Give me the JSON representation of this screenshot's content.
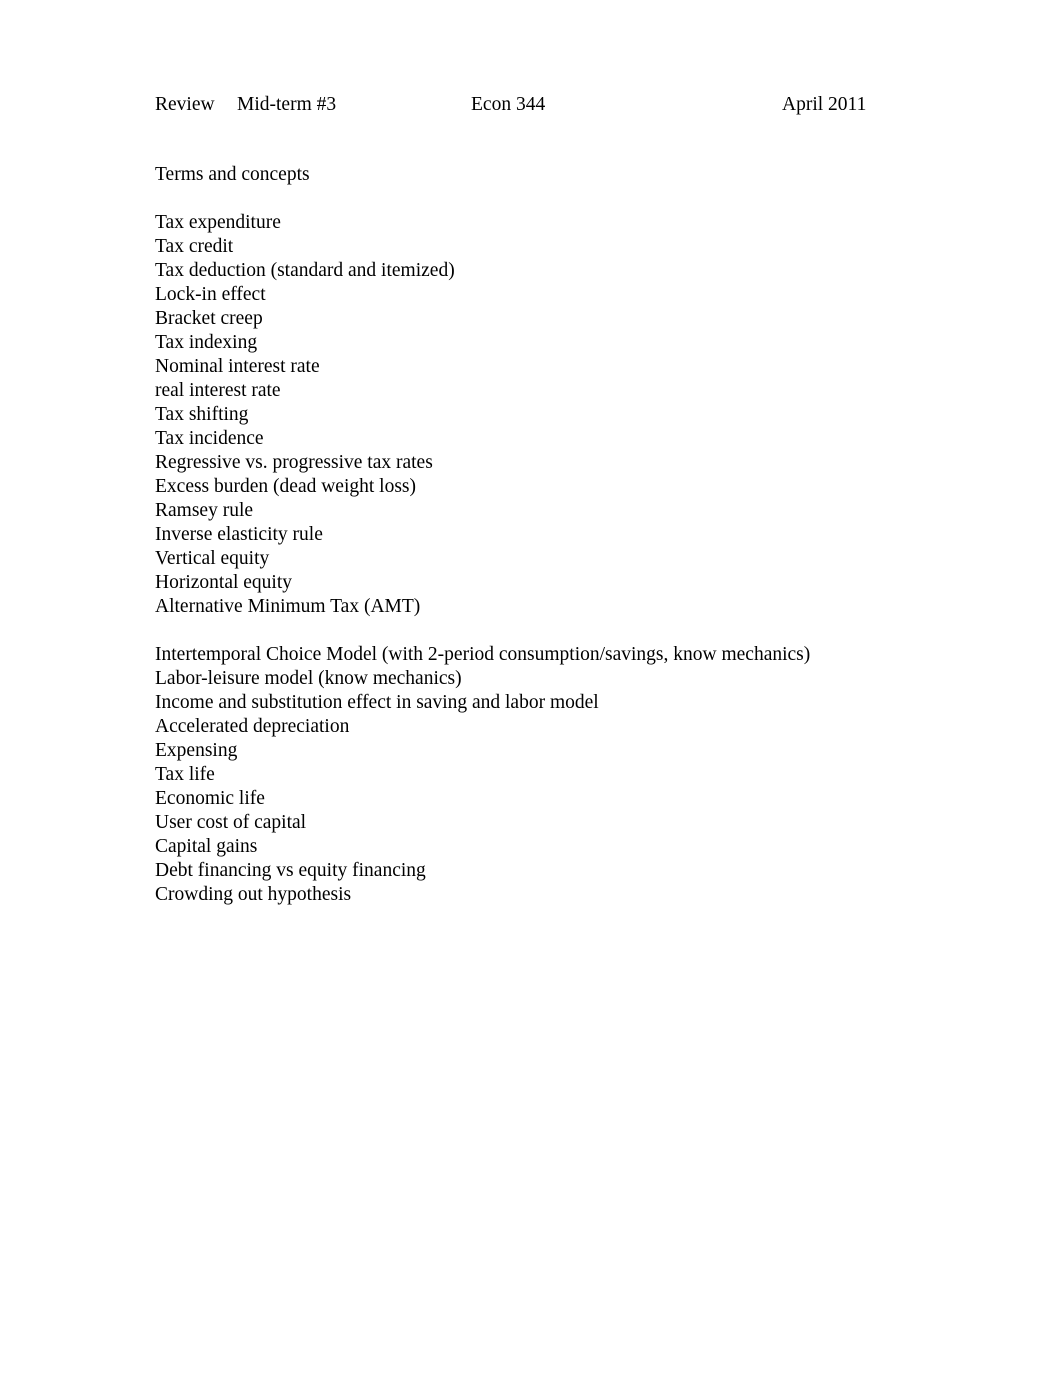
{
  "document": {
    "header": {
      "review_label": "Review",
      "exam_label": "Mid-term #3",
      "course_label": "Econ 344",
      "date_label": "April 2011"
    },
    "section_title": "Terms and concepts",
    "terms_group_one": [
      "Tax expenditure",
      "Tax credit",
      "Tax deduction (standard and itemized)",
      "Lock-in effect",
      "Bracket creep",
      "Tax indexing",
      "Nominal interest rate",
      "real interest rate",
      "Tax shifting",
      "Tax incidence",
      "Regressive vs. progressive tax rates",
      "Excess burden (dead weight loss)",
      "Ramsey rule",
      "Inverse elasticity rule",
      "Vertical equity",
      "Horizontal equity",
      "Alternative Minimum Tax (AMT)"
    ],
    "terms_group_two": [
      "Intertemporal Choice Model (with 2-period consumption/savings, know mechanics)",
      "Labor-leisure model (know mechanics)",
      "Income and substitution effect in saving and labor model",
      "Accelerated depreciation",
      "Expensing",
      "Tax life",
      "Economic life",
      "User cost of capital",
      "Capital gains",
      "Debt financing vs equity financing",
      "Crowding out hypothesis"
    ]
  }
}
